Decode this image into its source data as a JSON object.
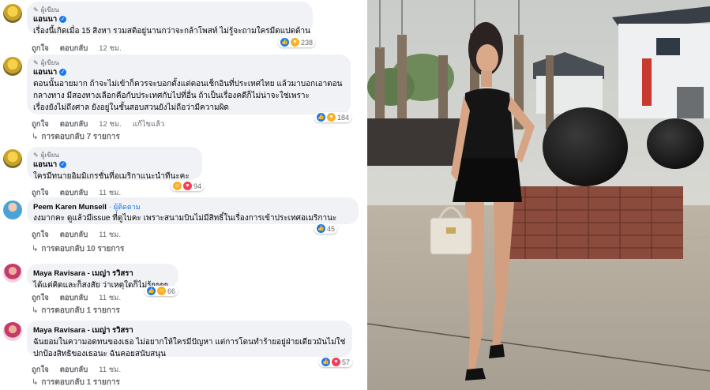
{
  "comments": [
    {
      "author_tag": "ผู้เขียน",
      "name": "แอนนา",
      "lines": [
        "เรื่องนี้เกิดเมื่อ 15 สิงหา รวมสติอยู่นานกว่าจะกล้าโพสท์ ไม่รู้จะถามใครมืดแปดด้าน"
      ],
      "actions": [
        "ถูกใจ",
        "ตอบกลับ",
        "12 ชม."
      ],
      "reaction_count": "238"
    },
    {
      "author_tag": "ผู้เขียน",
      "name": "แอนนา",
      "lines": [
        "ตอนนั้นอายมาก ถ้าจะไม่เข้าก็ควรจะบอกตั้งแต่ตอนเช็กอินที่ประเทศไทย แล้วมาบอกเอาตอน",
        "กลางทาง มีสองทางเลือกคือกับประเทศกับไปที่อื่น ถ้าเป็นเรื่องคดีก็ไม่น่าจะใช่เพราะ",
        "เรื่องยังไม่ถึงศาล ยังอยู่ในชั้นสอบสวนยังไม่ถือว่ามีความผิด"
      ],
      "actions": [
        "ถูกใจ",
        "ตอบกลับ",
        "12 ชม.",
        "แก้ไขแล้ว"
      ],
      "reaction_count": "184",
      "replies_label": "การตอบกลับ 7 รายการ"
    },
    {
      "author_tag": "ผู้เขียน",
      "name": "แอนนา",
      "lines": [
        "ใครมีทนายอิมมิเกรชั่นที่อเมริกาแนะนำทีนะคะ"
      ],
      "actions": [
        "ถูกใจ",
        "ตอบกลับ",
        "11 ชม."
      ],
      "reaction_count": "94"
    },
    {
      "name": "Peem Karen Munsell",
      "role": "ผู้ติดตาม",
      "lines": [
        "งงมากคะ ดูแล้วมีissue ที่ดูไบคะ เพราะสนามบินไม่มีสิทธิ์ในเรื่องการเข้าประเทศอเมริกานะ"
      ],
      "actions": [
        "ถูกใจ",
        "ตอบกลับ",
        "11 ชม."
      ],
      "reaction_count": "45",
      "replies_label": "การตอบกลับ 10 รายการ"
    },
    {
      "name": "Maya Ravisara - เมญ่า รวิสรา",
      "lines": [
        "ได้แต่คิดและก็สงสัย ว่าเหตุใดก็ไม่รู้ๆๆๆๆ"
      ],
      "actions": [
        "ถูกใจ",
        "ตอบกลับ",
        "11 ชม."
      ],
      "reaction_count": "66",
      "replies_label": "การตอบกลับ 1 รายการ"
    },
    {
      "name": "Maya Ravisara - เมญ่า รวิสรา",
      "lines": [
        "ฉันยอมในความอดทนของเธอ ไม่อยากให้ใครมีปัญหา แต่การโดนทำร้ายอยู่ฝ่ายเดียวมันไม่ใช่",
        "ปกป้องสิทธิของเธอนะ ฉันคอยสนับสนุน"
      ],
      "actions": [
        "ถูกใจ",
        "ตอบกลับ",
        "11 ชม."
      ],
      "reaction_count": "57",
      "replies_label": "การตอบกลับ 1 รายการ"
    }
  ],
  "icons": {
    "verified": "verified-check-icon",
    "reply_arrow": "reply-arrow-icon",
    "like": "like-icon",
    "care": "care-icon",
    "haha": "haha-icon",
    "love": "love-icon"
  },
  "colors": {
    "bubble": "#f0f2f5",
    "meta": "#65676b",
    "like": "#1877f2",
    "role_link": "#1877f2"
  }
}
